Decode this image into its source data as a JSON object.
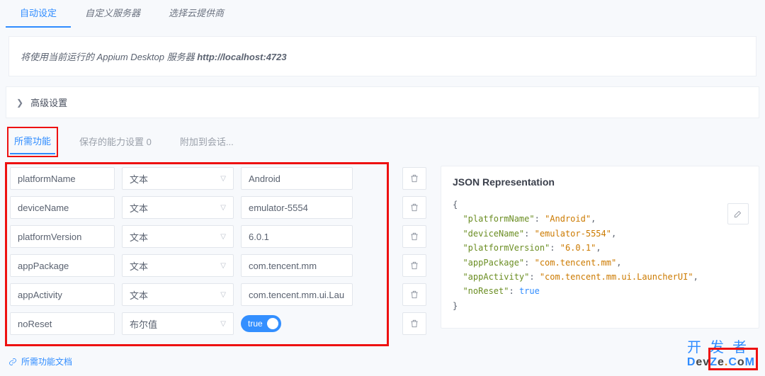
{
  "tabs": {
    "auto": "自动设定",
    "custom": "自定义服务器",
    "cloud": "选择云提供商"
  },
  "info": {
    "prefix": "将使用当前运行的 Appium Desktop 服务器 ",
    "bold": "http://localhost:4723"
  },
  "collapser": {
    "label": "高级设置"
  },
  "subtabs": {
    "caps": "所需功能",
    "saved": "保存的能力设置 0",
    "attach": "附加到会话..."
  },
  "type_labels": {
    "text": "文本",
    "bool": "布尔值"
  },
  "rows": [
    {
      "name": "platformName",
      "type": "文本",
      "value": "Android"
    },
    {
      "name": "deviceName",
      "type": "文本",
      "value": "emulator-5554"
    },
    {
      "name": "platformVersion",
      "type": "文本",
      "value": "6.0.1"
    },
    {
      "name": "appPackage",
      "type": "文本",
      "value": "com.tencent.mm"
    },
    {
      "name": "appActivity",
      "type": "文本",
      "value": "com.tencent.mm.ui.LauncherUI"
    },
    {
      "name": "noReset",
      "type": "布尔值",
      "value": "true"
    }
  ],
  "toggle": {
    "label": "true"
  },
  "json": {
    "title": "JSON Representation",
    "pairs": [
      {
        "k": "platformName",
        "v": "Android",
        "t": "s"
      },
      {
        "k": "deviceName",
        "v": "emulator-5554",
        "t": "s"
      },
      {
        "k": "platformVersion",
        "v": "6.0.1",
        "t": "s"
      },
      {
        "k": "appPackage",
        "v": "com.tencent.mm",
        "t": "s"
      },
      {
        "k": "appActivity",
        "v": "com.tencent.mm.ui.LauncherUI",
        "t": "s"
      },
      {
        "k": "noReset",
        "v": "true",
        "t": "b"
      }
    ]
  },
  "footer": {
    "link": "所需功能文档"
  },
  "brand": {
    "cn": "开发者",
    "en_parts": [
      "D",
      "e",
      "v",
      "Z",
      "e",
      ".",
      "C",
      "o",
      "M"
    ]
  }
}
